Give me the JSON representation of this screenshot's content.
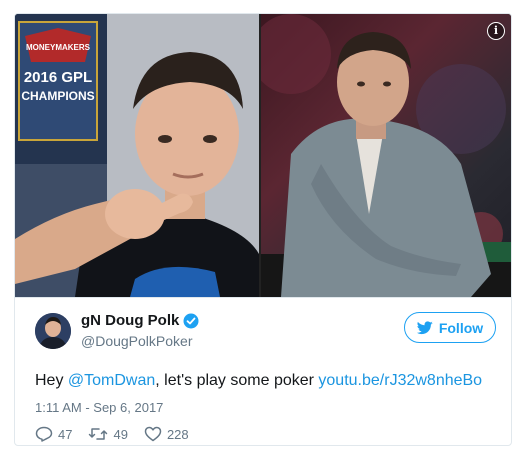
{
  "media": {
    "info_icon": "info-icon",
    "left_photo": "man-pointing-at-camera",
    "right_photo": "man-in-grey-hoodie-at-poker-table"
  },
  "tweet": {
    "display_name": "gN Doug Polk",
    "handle": "@DougPolkPoker",
    "verified_icon": "verified-badge-icon",
    "follow_label": "Follow",
    "text_prefix": "Hey ",
    "mention": "@TomDwan",
    "text_middle": ", let's play some poker ",
    "link": "youtu.be/rJ32w8nheBo",
    "timestamp": "1:11 AM - Sep 6, 2017",
    "stats": {
      "replies": "47",
      "retweets": "49",
      "likes": "228"
    }
  },
  "colors": {
    "accent": "#1da1f2",
    "link": "#1b95e0",
    "text": "#14171a",
    "muted": "#657786",
    "border": "#e1e8ed"
  }
}
